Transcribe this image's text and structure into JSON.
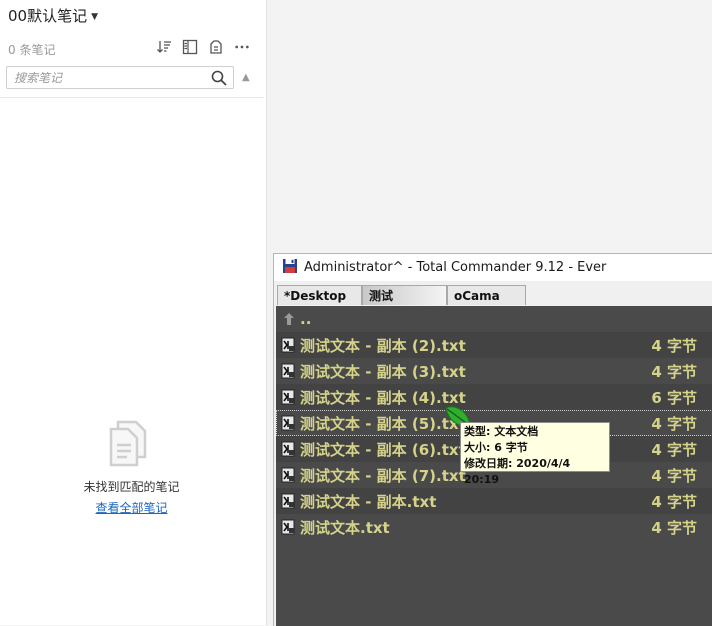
{
  "notes": {
    "notebook_title": "00默认笔记",
    "count": "0 条笔记",
    "search_placeholder": "搜索笔记",
    "empty_message": "未找到匹配的笔记",
    "empty_link": "查看全部笔记"
  },
  "tc": {
    "title": "Administrator^ - Total Commander 9.12 - Ever",
    "tabs": [
      "*Desktop",
      "测试",
      "oCama"
    ],
    "parent": "..",
    "files": [
      {
        "name": "测试文本 - 副本 (2).txt",
        "size": "4 字节"
      },
      {
        "name": "测试文本 - 副本 (3).txt",
        "size": "4 字节"
      },
      {
        "name": "测试文本 - 副本 (4).txt",
        "size": "6 字节"
      },
      {
        "name": "测试文本 - 副本 (5).txt",
        "size": "4 字节"
      },
      {
        "name": "测试文本 - 副本 (6).txt",
        "size": "4 字节"
      },
      {
        "name": "测试文本 - 副本 (7).txt",
        "size": "4 字节"
      },
      {
        "name": "测试文本 - 副本.txt",
        "size": "4 字节"
      },
      {
        "name": "测试文本.txt",
        "size": "4 字节"
      }
    ],
    "tooltip": {
      "type": "类型: 文本文档",
      "size": "大小: 6 字节",
      "modified": "修改日期: 2020/4/4 20:19"
    }
  },
  "colors": {
    "panel_bg": "#4a4a4a",
    "file_text": "#d5d38a",
    "link": "#1a66c2",
    "tooltip_bg": "#ffffe1"
  }
}
